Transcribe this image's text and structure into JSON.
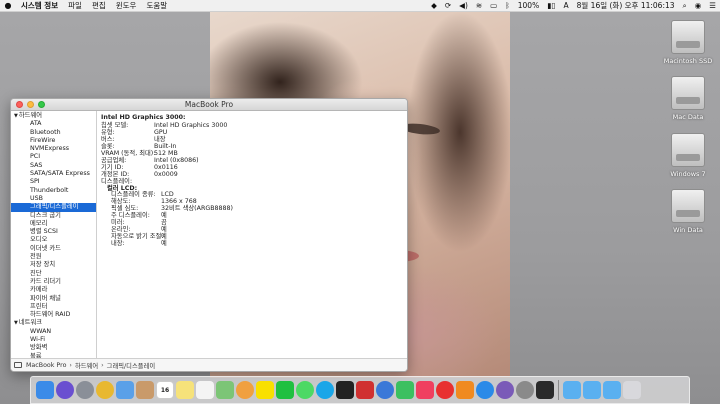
{
  "menubar": {
    "app_name": "시스템 정보",
    "menus": [
      "파일",
      "편집",
      "윈도우",
      "도움말"
    ],
    "battery": "100%",
    "input_source": "A",
    "datetime": "8월 16일 (화) 오후 11:06:13"
  },
  "desktop": {
    "drives": [
      "Macintosh SSD",
      "Mac Data",
      "Windows 7",
      "Win Data"
    ]
  },
  "window": {
    "title": "MacBook Pro",
    "sidebar": {
      "group1": "하드웨어",
      "hardware_items": [
        "ATA",
        "Bluetooth",
        "FireWire",
        "NVMExpress",
        "PCI",
        "SAS",
        "SATA/SATA Express",
        "SPI",
        "Thunderbolt",
        "USB",
        "그래픽/디스플레이",
        "디스크 굽기",
        "메모리",
        "병렬 SCSI",
        "오디오",
        "이더넷 카드",
        "전원",
        "저장 장치",
        "진단",
        "카드 리더기",
        "카메라",
        "파이버 채널",
        "프린터",
        "하드웨어 RAID"
      ],
      "selected": "그래픽/디스플레이",
      "group2": "네트워크",
      "network_items": [
        "WWAN",
        "Wi-Fi",
        "방화벽",
        "볼륨"
      ]
    },
    "detail": {
      "heading": "Intel HD Graphics 3000:",
      "rows": [
        {
          "k": "칩셋 모델:",
          "v": "Intel HD Graphics 3000"
        },
        {
          "k": "유형:",
          "v": "GPU"
        },
        {
          "k": "버스:",
          "v": "내장"
        },
        {
          "k": "슬롯:",
          "v": "Built-In"
        },
        {
          "k": "VRAM (동적, 최대):",
          "v": "512 MB"
        },
        {
          "k": "공급업체:",
          "v": "Intel (0x8086)"
        },
        {
          "k": "기기 ID:",
          "v": "0x0116"
        },
        {
          "k": "개정본 ID:",
          "v": "0x0009"
        },
        {
          "k": "디스플레이:",
          "v": ""
        }
      ],
      "display_heading": "컬러 LCD:",
      "display_rows": [
        {
          "k": "디스플레이 종류:",
          "v": "LCD"
        },
        {
          "k": "해상도:",
          "v": "1366 x 768"
        },
        {
          "k": "픽셀 심도:",
          "v": "32비트 색상(ARGB8888)"
        },
        {
          "k": "주 디스플레이:",
          "v": "예"
        },
        {
          "k": "미러:",
          "v": "끔"
        },
        {
          "k": "온라인:",
          "v": "예"
        },
        {
          "k": "자동으로 밝기 조절:",
          "v": "예"
        },
        {
          "k": "내장:",
          "v": "예"
        }
      ]
    },
    "pathbar": [
      "MacBook Pro",
      "하드웨어",
      "그래픽/디스플레이"
    ]
  },
  "dock": {
    "badge": "16",
    "icons": [
      {
        "name": "finder-icon",
        "color": "#3b8be8",
        "round": false
      },
      {
        "name": "siri-icon",
        "color": "#6a4fd0",
        "round": true
      },
      {
        "name": "launchpad-icon",
        "color": "#8a8f98",
        "round": true
      },
      {
        "name": "chrome-icon",
        "color": "#e8b830",
        "round": true
      },
      {
        "name": "mail-icon",
        "color": "#5aa0e8",
        "round": false
      },
      {
        "name": "contacts-icon",
        "color": "#c99a6a",
        "round": false
      },
      {
        "name": "calendar-icon",
        "color": "#ffffff",
        "round": false
      },
      {
        "name": "notes-icon",
        "color": "#f6e27a",
        "round": false
      },
      {
        "name": "reminders-icon",
        "color": "#f4f4f4",
        "round": false
      },
      {
        "name": "maps-icon",
        "color": "#7cc576",
        "round": false
      },
      {
        "name": "photos-icon",
        "color": "#f0a040",
        "round": true
      },
      {
        "name": "kakaotalk-icon",
        "color": "#f9e000",
        "round": false
      },
      {
        "name": "line-icon",
        "color": "#20c040",
        "round": false
      },
      {
        "name": "messages-icon",
        "color": "#4cd964",
        "round": true
      },
      {
        "name": "skype-icon",
        "color": "#1aa6e8",
        "round": true
      },
      {
        "name": "app-icon-a",
        "color": "#222222",
        "round": false
      },
      {
        "name": "app-icon-b",
        "color": "#d03030",
        "round": false
      },
      {
        "name": "app-icon-c",
        "color": "#3a78d8",
        "round": true
      },
      {
        "name": "facetime-icon",
        "color": "#3cc060",
        "round": false
      },
      {
        "name": "music-icon",
        "color": "#f04060",
        "round": false
      },
      {
        "name": "app-icon-d",
        "color": "#e83030",
        "round": true
      },
      {
        "name": "ibooks-icon",
        "color": "#f08a20",
        "round": false
      },
      {
        "name": "appstore-icon",
        "color": "#2a8ae8",
        "round": true
      },
      {
        "name": "system-info-icon",
        "color": "#7a5ab8",
        "round": true
      },
      {
        "name": "preferences-icon",
        "color": "#8a8a8a",
        "round": true
      },
      {
        "name": "app-icon-e",
        "color": "#2a2a2a",
        "round": false
      }
    ],
    "folders": [
      {
        "name": "applications-folder-icon",
        "color": "#5ab0f0"
      },
      {
        "name": "documents-folder-icon",
        "color": "#5ab0f0"
      },
      {
        "name": "downloads-folder-icon",
        "color": "#5ab0f0"
      },
      {
        "name": "trash-icon",
        "color": "#d8d8dc"
      }
    ]
  }
}
